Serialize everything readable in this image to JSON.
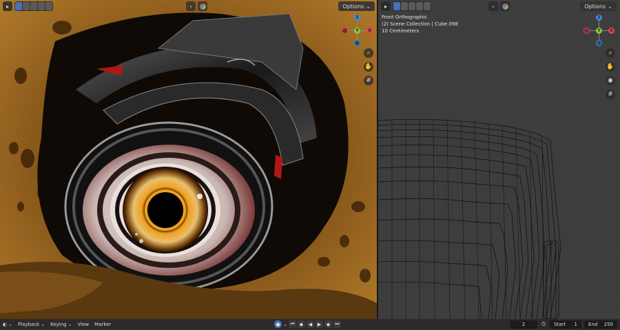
{
  "left_viewport": {
    "options_label": "Options",
    "gizmo": {
      "z": "Z",
      "y": "Y",
      "x": "X"
    }
  },
  "right_viewport": {
    "options_label": "Options",
    "view_name": "Front Orthographic",
    "collection_info": "(2) Scene Collection | Cube.098",
    "scale_info": "10 Centimeters",
    "gizmo": {
      "z": "Z",
      "y": "Y",
      "x": "X"
    }
  },
  "timeline": {
    "playback_label": "Playback",
    "keying_label": "Keying",
    "view_label": "View",
    "marker_label": "Marker",
    "current_frame": "2",
    "start_label": "Start",
    "start_value": "1",
    "end_label": "End",
    "end_value": "250"
  },
  "colors": {
    "accent": "#4772b3",
    "axis_x": "#e0455a",
    "axis_y": "#8dc63f",
    "axis_z": "#3f8fe0"
  }
}
